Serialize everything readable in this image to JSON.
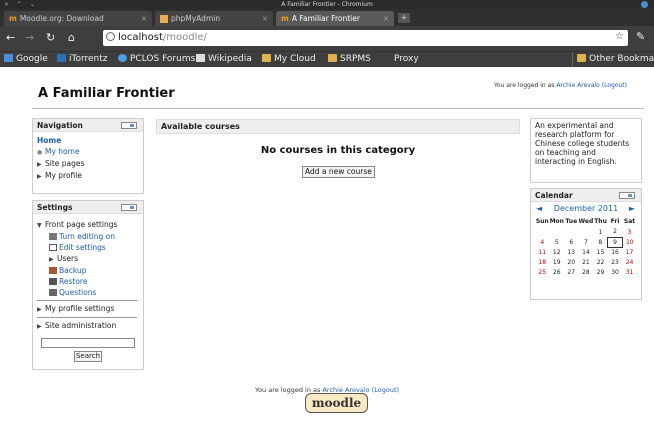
{
  "window": {
    "title": "A Familiar Frontier - Chromium"
  },
  "tabs": [
    {
      "label": "Moodle.org: Download",
      "active": false
    },
    {
      "label": "phpMyAdmin",
      "active": false
    },
    {
      "label": "A Familiar Frontier",
      "active": true
    }
  ],
  "toolbar": {
    "url_host": "localhost",
    "url_path": "/moodle/"
  },
  "bookmarks": [
    "Google",
    "iTorrentz",
    "PCLOS Forums",
    "Wikipedia",
    "My Cloud",
    "SRPMS",
    "Proxy"
  ],
  "other_bookmarks": "Other Bookmarks",
  "header": {
    "site_title": "A Familiar Frontier",
    "login_prefix": "You are logged in as",
    "user": "Archie Arevalo",
    "logout": "(Logout)"
  },
  "navigation": {
    "title": "Navigation",
    "home": "Home",
    "my_home": "My home",
    "site_pages": "Site pages",
    "my_profile": "My profile"
  },
  "settings": {
    "title": "Settings",
    "front_page": "Front page settings",
    "items": [
      "Turn editing on",
      "Edit settings",
      "Users",
      "Backup",
      "Restore",
      "Questions"
    ],
    "my_profile_settings": "My profile settings",
    "site_admin": "Site administration",
    "search_button": "Search"
  },
  "main": {
    "heading": "Available courses",
    "message": "No courses in this category",
    "add_button": "Add a new course"
  },
  "summary": "An experimental and research platform for Chinese college students on teaching and interacting in English.",
  "calendar": {
    "title": "Calendar",
    "month": "December 2011",
    "prev": "◄",
    "next": "►",
    "days": [
      "Sun",
      "Mon",
      "Tue",
      "Wed",
      "Thu",
      "Fri",
      "Sat"
    ],
    "weeks": [
      [
        "",
        "",
        "",
        "",
        "1",
        "2",
        "3"
      ],
      [
        "4",
        "5",
        "6",
        "7",
        "8",
        "9",
        "10"
      ],
      [
        "11",
        "12",
        "13",
        "14",
        "15",
        "16",
        "17"
      ],
      [
        "18",
        "19",
        "20",
        "21",
        "22",
        "23",
        "24"
      ],
      [
        "25",
        "26",
        "27",
        "28",
        "29",
        "30",
        "31"
      ]
    ],
    "today": "9"
  },
  "footer": {
    "login_prefix": "You are logged in as",
    "user": "Archie Arevalo",
    "logout": "(Logout)",
    "logo": "moodle"
  },
  "colors": {
    "link": "#1a5fb4",
    "weekend": "#b00000",
    "folder": "#e0b24a"
  }
}
